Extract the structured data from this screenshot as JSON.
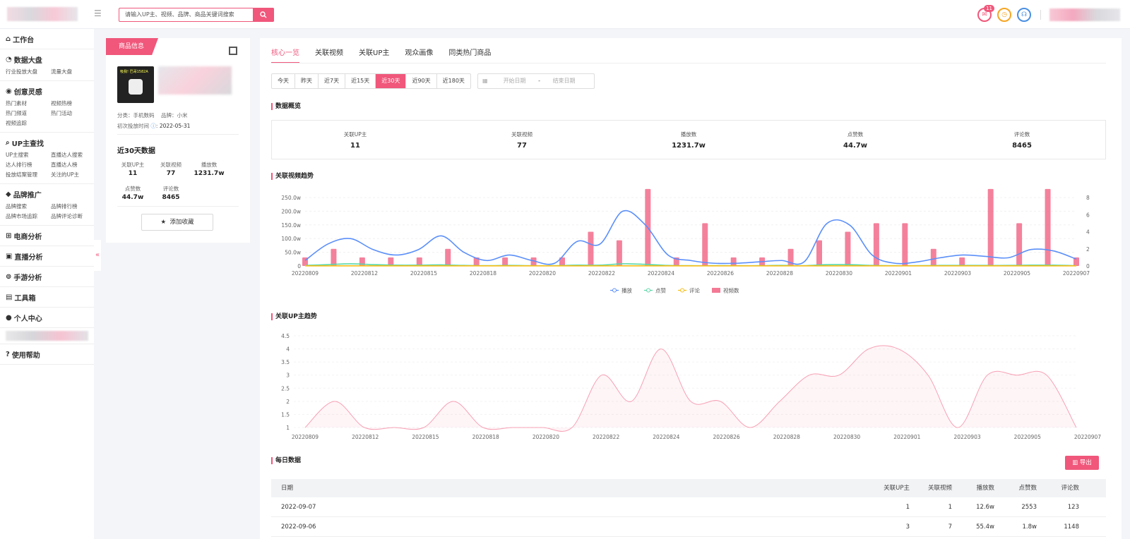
{
  "header": {
    "search_placeholder": "请输入UP主、视频、品牌、商品关键词搜索",
    "mail_badge": "11"
  },
  "sidebar": {
    "workbench": "工作台",
    "sections": [
      {
        "title": "数据大盘",
        "items": [
          "行业投放大盘",
          "流量大盘"
        ]
      },
      {
        "title": "创意灵感",
        "items": [
          "热门素材",
          "视频热榜",
          "热门频道",
          "热门活动",
          "视频追踪"
        ]
      },
      {
        "title": "UP主查找",
        "items": [
          "UP主搜索",
          "直播达人搜索",
          "达人排行榜",
          "直播达人榜",
          "投放结案管理",
          "关注的UP主"
        ]
      },
      {
        "title": "品牌推广",
        "items": [
          "品牌搜索",
          "品牌排行榜",
          "品牌市场追踪",
          "品牌评论诊断"
        ]
      }
    ],
    "single": [
      "电商分析",
      "直播分析",
      "手游分析",
      "工具箱",
      "个人中心"
    ],
    "help": "使用帮助"
  },
  "product": {
    "tab_label": "商品信息",
    "image_text": "吸我! 巴哥1582A",
    "category_label": "分类：手机数码",
    "brand_label": "品牌：小米",
    "first_label": "初次投放时间",
    "first_date": "2022-05-31",
    "period_title": "近30天数据",
    "stats": [
      {
        "label": "关联UP主",
        "value": "11"
      },
      {
        "label": "关联视频",
        "value": "77"
      },
      {
        "label": "播放数",
        "value": "1231.7w"
      },
      {
        "label": "点赞数",
        "value": "44.7w"
      },
      {
        "label": "评论数",
        "value": "8465"
      }
    ],
    "fav_button": "添加收藏"
  },
  "main": {
    "tabs": [
      "核心一览",
      "关联视频",
      "关联UP主",
      "观众画像",
      "同类热门商品"
    ],
    "ranges": [
      "今天",
      "昨天",
      "近7天",
      "近15天",
      "近30天",
      "近90天",
      "近180天"
    ],
    "active_range": "近30天",
    "date_start": "开始日期",
    "date_sep": "-",
    "date_end": "结束日期",
    "overview_title": "数据概览",
    "overview": [
      {
        "label": "关联UP主",
        "value": "11"
      },
      {
        "label": "关联视频",
        "value": "77"
      },
      {
        "label": "播放数",
        "value": "1231.7w"
      },
      {
        "label": "点赞数",
        "value": "44.7w"
      },
      {
        "label": "评论数",
        "value": "8465"
      }
    ],
    "trend_title": "关联视频趋势",
    "up_trend_title": "关联UP主趋势",
    "daily_title": "每日数据",
    "export": "导出",
    "table_headers": [
      "日期",
      "关联UP主",
      "关联视频",
      "播放数",
      "点赞数",
      "评论数"
    ],
    "table_rows": [
      [
        "2022-09-07",
        "1",
        "1",
        "12.6w",
        "2553",
        "123"
      ],
      [
        "2022-09-06",
        "3",
        "7",
        "55.4w",
        "1.8w",
        "1148"
      ]
    ]
  },
  "chart_data": [
    {
      "type": "bar",
      "x_ticks": [
        "20220809",
        "20220812",
        "20220815",
        "20220818",
        "20220820",
        "20220822",
        "20220824",
        "20220826",
        "20220828",
        "20220830",
        "20220901",
        "20220903",
        "20220905",
        "20220907"
      ],
      "y_left_ticks": [
        "250.0w",
        "200.0w",
        "150.0w",
        "100.0w",
        "50.0w",
        "0"
      ],
      "y_right_ticks": [
        "8",
        "6",
        "4",
        "2",
        "0"
      ],
      "legend": [
        "播放",
        "点赞",
        "评论",
        "视频数"
      ],
      "bar_series": {
        "name": "视频数",
        "values": [
          1,
          2,
          1,
          1,
          1,
          2,
          1,
          1,
          1,
          1,
          4,
          3,
          9,
          1,
          5,
          1,
          1,
          2,
          3,
          4,
          5,
          5,
          2,
          1,
          9,
          5,
          9,
          1
        ]
      },
      "line_series": [
        {
          "name": "播放",
          "values": [
            20,
            80,
            100,
            60,
            40,
            60,
            110,
            50,
            20,
            40,
            20,
            10,
            90,
            80,
            200,
            150,
            40,
            20,
            10,
            10,
            15,
            20,
            15,
            155,
            150,
            40,
            10,
            15,
            30,
            40,
            35,
            30,
            60,
            55,
            25
          ]
        },
        {
          "name": "点赞",
          "values": [
            2,
            5,
            8,
            5,
            3,
            3,
            4,
            2,
            1,
            2,
            1,
            1,
            3,
            3,
            8,
            6,
            2,
            1,
            1,
            1,
            1,
            2,
            1,
            5,
            5,
            2,
            1,
            1,
            2,
            2,
            2,
            2,
            3,
            3,
            1
          ]
        },
        {
          "name": "评论",
          "values": [
            0.5,
            0.5,
            0.5,
            0.5,
            0.5,
            0.5,
            0.5,
            0.5,
            0.5,
            0.5,
            0.5,
            0.5,
            0.5,
            0.5,
            0.5,
            0.5,
            0.5,
            0.5,
            0.5,
            0.5,
            0.5,
            0.5,
            0.5,
            0.5,
            0.5,
            0.5,
            0.5,
            0.5,
            0.5,
            0.5,
            0.5,
            0.5,
            0.5,
            0.5,
            0.5
          ]
        }
      ],
      "colors": {
        "播放": "#5b8ff9",
        "点赞": "#5ad8a6",
        "评论": "#f6bd16",
        "视频数": "#f0577b"
      }
    },
    {
      "type": "area",
      "x_ticks": [
        "20220809",
        "20220812",
        "20220815",
        "20220818",
        "20220820",
        "20220822",
        "20220824",
        "20220826",
        "20220828",
        "20220830",
        "20220901",
        "20220903",
        "20220905",
        "20220907"
      ],
      "y_ticks": [
        "4.5",
        "4",
        "3.5",
        "3",
        "2.5",
        "2",
        "1.5",
        "1"
      ],
      "series": [
        {
          "name": "关联UP主",
          "values": [
            1,
            2,
            1,
            1,
            1,
            2,
            1,
            1,
            1,
            1,
            3,
            2,
            4,
            2,
            2,
            1,
            2,
            3,
            3,
            4,
            4,
            3,
            1,
            3,
            3,
            3,
            1
          ]
        }
      ],
      "color": "#f0577b"
    }
  ]
}
